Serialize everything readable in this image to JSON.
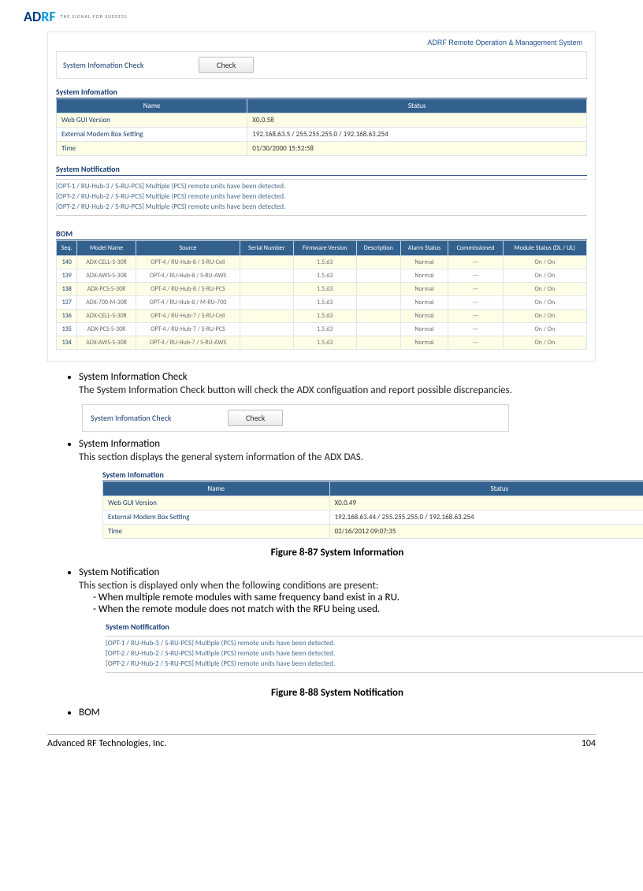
{
  "header": {
    "logo_ad": "AD",
    "logo_rf": "RF",
    "tagline": "THE SIGNAL FOR SUCCESS"
  },
  "shot1": {
    "banner": "ADRF Remote Operation & Management System",
    "check_label": "System Infomation Check",
    "check_button": "Check",
    "sys_info_title": "System Infomation",
    "sys_headers": {
      "name": "Name",
      "status": "Status"
    },
    "sys_rows": [
      {
        "name": "Web GUI Version",
        "status": "X0.0.58"
      },
      {
        "name": "External Modem Box Setting",
        "status": "192.168.63.5 / 255.255.255.0 / 192.168.63.254"
      },
      {
        "name": "Time",
        "status": "01/30/2000 15:52:58"
      }
    ],
    "notif_title": "System Notification",
    "notif_lines": [
      "[OPT-1 / RU-Hub-3 / S-RU-PCS] Multiple (PCS) remote units have been detected.",
      "[OPT-2 / RU-Hub-2 / S-RU-PCS] Multiple (PCS) remote units have been detected.",
      "[OPT-2 / RU-Hub-2 / S-RU-PCS] Multiple (PCS) remote units have been detected."
    ],
    "bom_title": "BOM",
    "bom_headers": [
      "Seq.",
      "Model Name",
      "Source",
      "Serial Number",
      "Firmware Version",
      "Description",
      "Alarm Status",
      "Commissioned",
      "Module Status (DL / UL)"
    ],
    "bom_rows": [
      {
        "seq": "140",
        "model": "ADX-CELL-S-30R",
        "source": "OPT-4 / RU-Hub-8 / S-RU-Cell",
        "sn": "",
        "fw": "1.5.63",
        "desc": "",
        "alarm": "Normal",
        "comm": "---",
        "mod": "On / On"
      },
      {
        "seq": "139",
        "model": "ADX-AWS-S-30R",
        "source": "OPT-4 / RU-Hub-8 / S-RU-AWS",
        "sn": "",
        "fw": "1.5.63",
        "desc": "",
        "alarm": "Normal",
        "comm": "---",
        "mod": "On / On"
      },
      {
        "seq": "138",
        "model": "ADX-PCS-S-30R",
        "source": "OPT-4 / RU-Hub-8 / S-RU-PCS",
        "sn": "",
        "fw": "1.5.63",
        "desc": "",
        "alarm": "Normal",
        "comm": "---",
        "mod": "On / On"
      },
      {
        "seq": "137",
        "model": "ADX-700-M-30R",
        "source": "OPT-4 / RU-Hub-8 / M-RU-700",
        "sn": "",
        "fw": "1.5.63",
        "desc": "",
        "alarm": "Normal",
        "comm": "---",
        "mod": "On / On"
      },
      {
        "seq": "136",
        "model": "ADX-CELL-S-30R",
        "source": "OPT-4 / RU-Hub-7 / S-RU-Cell",
        "sn": "",
        "fw": "1.5.63",
        "desc": "",
        "alarm": "Normal",
        "comm": "---",
        "mod": "On / On"
      },
      {
        "seq": "135",
        "model": "ADX-PCS-S-30R",
        "source": "OPT-4 / RU-Hub-7 / S-RU-PCS",
        "sn": "",
        "fw": "1.5.63",
        "desc": "",
        "alarm": "Normal",
        "comm": "---",
        "mod": "On / On"
      },
      {
        "seq": "134",
        "model": "ADX-AWS-S-30R",
        "source": "OPT-4 / RU-Hub-7 / S-RU-AWS",
        "sn": "",
        "fw": "1.5.63",
        "desc": "",
        "alarm": "Normal",
        "comm": "---",
        "mod": "On / On"
      }
    ]
  },
  "doc": {
    "b1_title": "System Information Check",
    "b1_body": "The System Information Check button will check the ADX configuation and report possible discrepancies.",
    "mini_check_label": "System Infomation Check",
    "mini_check_button": "Check",
    "b2_title": "System Information",
    "b2_body": "This section displays the general system information of the ADX DAS.",
    "sys2_title": "System Infomation",
    "sys2_headers": {
      "name": "Name",
      "status": "Status"
    },
    "sys2_rows": [
      {
        "name": "Web GUI Version",
        "status": "X0.0.49"
      },
      {
        "name": "External Modem Box Setting",
        "status": "192.168.63.44 / 255.255.255.0 / 192.168.63.254"
      },
      {
        "name": "Time",
        "status": "02/16/2012 09:07:35"
      }
    ],
    "fig87": "Figure 8-87   System Information",
    "b3_title": "System Notification",
    "b3_body": "This section is displayed only when the following conditions are present:",
    "b3_sub1": "When multiple remote modules with same frequency band exist in a RU.",
    "b3_sub2": "When the remote module does not match with the RFU being used.",
    "notif2_title": "System Notification",
    "notif2_lines": [
      "[OPT-1 / RU-Hub-3 / S-RU-PCS] Multiple (PCS) remote units have been detected.",
      "[OPT-2 / RU-Hub-2 / S-RU-PCS] Multiple (PCS) remote units have been detected.",
      "[OPT-2 / RU-Hub-2 / S-RU-PCS] Multiple (PCS) remote units have been detected."
    ],
    "fig88": "Figure 8-88   System Notification",
    "b4_title": "BOM"
  },
  "footer": {
    "left": "Advanced RF Technologies, Inc.",
    "right": "104"
  }
}
